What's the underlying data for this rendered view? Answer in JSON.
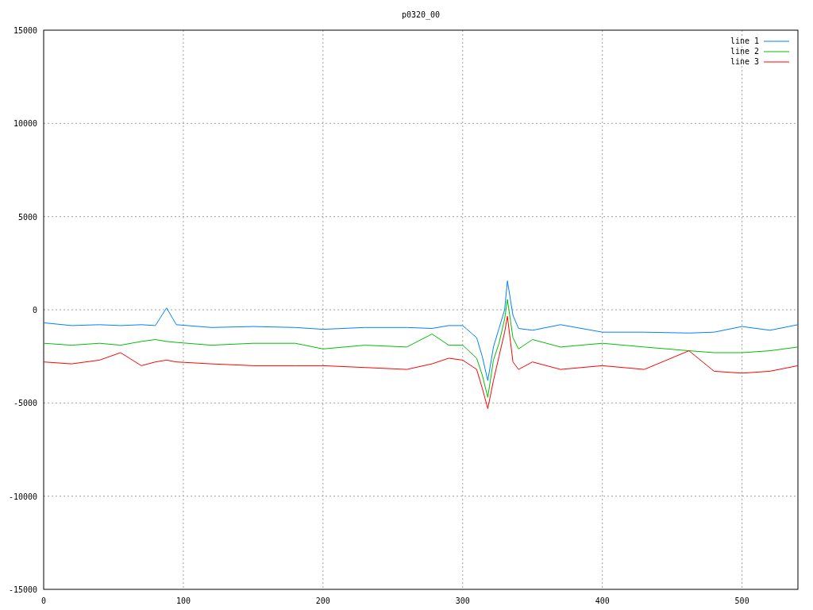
{
  "chart": {
    "chart_data": {
      "type": "line",
      "title": "p0320_00",
      "x": [
        0,
        20,
        40,
        55,
        70,
        80,
        88,
        95,
        120,
        150,
        180,
        200,
        230,
        260,
        278,
        290,
        300,
        310,
        314,
        318,
        322,
        326,
        330,
        332,
        336,
        340,
        350,
        370,
        400,
        430,
        462,
        480,
        500,
        520,
        540
      ],
      "series": [
        {
          "name": "line 1",
          "color": "#0080ff",
          "values": [
            -700,
            -850,
            -800,
            -850,
            -800,
            -850,
            100,
            -800,
            -950,
            -900,
            -950,
            -1050,
            -950,
            -950,
            -1000,
            -850,
            -850,
            -1500,
            -2500,
            -3800,
            -2000,
            -1000,
            0,
            1550,
            -300,
            -1000,
            -1100,
            -800,
            -1200,
            -1200,
            -1250,
            -1200,
            -900,
            -1100,
            -800
          ]
        },
        {
          "name": "line 2",
          "color": "#00c000",
          "values": [
            -1800,
            -1900,
            -1800,
            -1900,
            -1700,
            -1600,
            -1700,
            -1750,
            -1900,
            -1800,
            -1800,
            -2100,
            -1900,
            -2000,
            -1300,
            -1900,
            -1900,
            -2600,
            -3500,
            -4700,
            -2700,
            -1800,
            -500,
            550,
            -1500,
            -2100,
            -1600,
            -2000,
            -1800,
            -2000,
            -2200,
            -2300,
            -2300,
            -2200,
            -2000
          ]
        },
        {
          "name": "line 3",
          "color": "#ff0000",
          "values": [
            -2800,
            -2900,
            -2700,
            -2300,
            -3000,
            -2800,
            -2700,
            -2800,
            -2900,
            -3000,
            -3000,
            -3000,
            -3100,
            -3200,
            -2900,
            -2600,
            -2700,
            -3200,
            -4200,
            -5300,
            -3800,
            -2500,
            -1200,
            -350,
            -2800,
            -3200,
            -2800,
            -3200,
            -3000,
            -3200,
            -2200,
            -3300,
            -3400,
            -3300,
            -3000
          ]
        }
      ],
      "xlim": [
        0,
        540
      ],
      "ylim": [
        -15000,
        15000
      ],
      "xticks": [
        0,
        100,
        200,
        300,
        400,
        500
      ],
      "yticks": [
        -15000,
        -10000,
        -5000,
        0,
        5000,
        10000,
        15000
      ],
      "grid": true,
      "legend": true
    }
  }
}
